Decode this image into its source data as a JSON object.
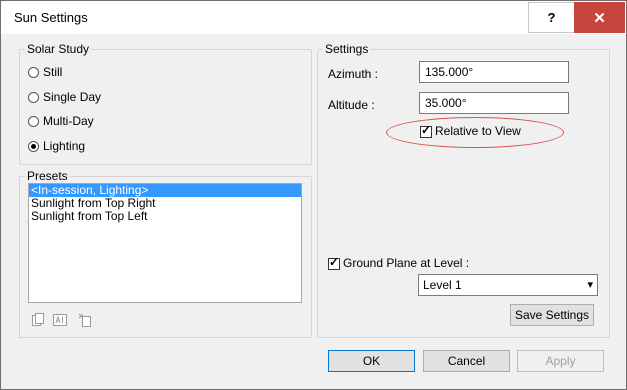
{
  "window": {
    "title": "Sun Settings",
    "help_label": "?",
    "close_label": "✕"
  },
  "solar_study": {
    "label": "Solar Study",
    "options": [
      {
        "label": "Still",
        "selected": false
      },
      {
        "label": "Single Day",
        "selected": false
      },
      {
        "label": "Multi-Day",
        "selected": false
      },
      {
        "label": "Lighting",
        "selected": true
      }
    ]
  },
  "presets": {
    "label": "Presets",
    "items": [
      {
        "label": "<In-session, Lighting>",
        "selected": true
      },
      {
        "label": "Sunlight from Top Right",
        "selected": false
      },
      {
        "label": "Sunlight from Top Left",
        "selected": false
      }
    ],
    "tools": [
      "duplicate-icon",
      "rename-icon",
      "delete-icon"
    ]
  },
  "settings": {
    "label": "Settings",
    "azimuth_label": "Azimuth :",
    "azimuth_value": "135.000°",
    "altitude_label": "Altitude :",
    "altitude_value": "35.000°",
    "relative_to_view_label": "Relative to View",
    "relative_to_view_checked": true,
    "ground_plane_label": "Ground Plane at Level :",
    "ground_plane_checked": true,
    "level_value": "Level 1",
    "save_settings_label": "Save Settings"
  },
  "footer": {
    "ok_label": "OK",
    "cancel_label": "Cancel",
    "apply_label": "Apply"
  },
  "colors": {
    "selection": "#3399ff",
    "close_button": "#c7453c",
    "annotation": "#d9534f"
  }
}
